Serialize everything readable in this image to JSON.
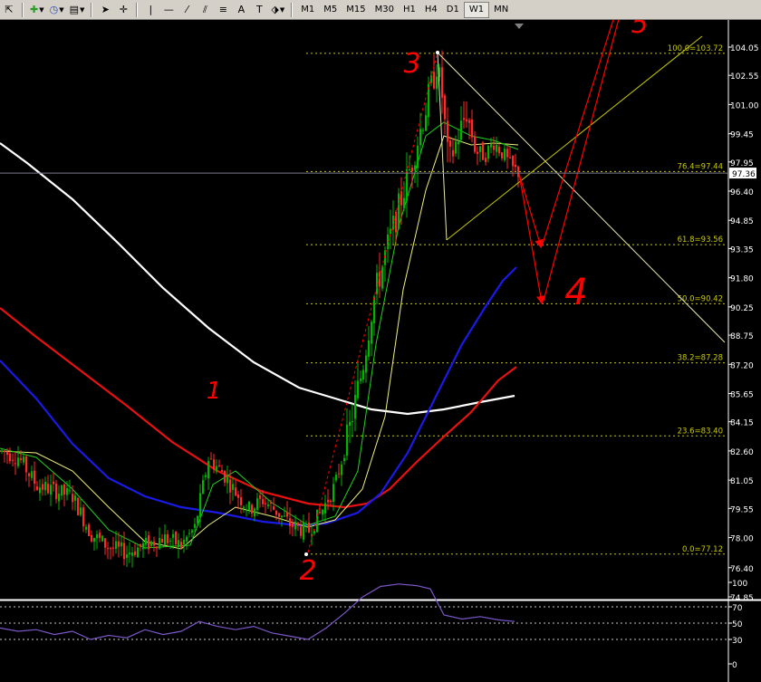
{
  "toolbar": {
    "timeframes": [
      "M1",
      "M5",
      "M15",
      "M30",
      "H1",
      "H4",
      "D1",
      "W1",
      "MN"
    ],
    "active_timeframe": "W1"
  },
  "chart_data": {
    "type": "candlestick",
    "price_axis": {
      "min": 74.85,
      "max": 104.05,
      "ticks": [
        "104.05",
        "102.55",
        "101.00",
        "99.45",
        "97.95",
        "96.40",
        "94.85",
        "93.35",
        "91.80",
        "90.25",
        "88.75",
        "87.20",
        "85.65",
        "84.15",
        "82.60",
        "81.05",
        "79.55",
        "78.00",
        "76.40",
        "74.85"
      ]
    },
    "current_price": "97.36",
    "fibonacci": [
      {
        "level": "100.0",
        "price": "103.72",
        "label": "100.0=103.72"
      },
      {
        "level": "76.4",
        "price": "97.44",
        "label": "76.4=97.44"
      },
      {
        "level": "61.8",
        "price": "93.56",
        "label": "61.8=93.56"
      },
      {
        "level": "50.0",
        "price": "90.42",
        "label": "50.0=90.42"
      },
      {
        "level": "38.2",
        "price": "87.28",
        "label": "38.2=87.28"
      },
      {
        "level": "23.6",
        "price": "83.40",
        "label": "23.6=83.40"
      },
      {
        "level": "0.0",
        "price": "77.12",
        "label": "0.0=77.12"
      }
    ],
    "annotations": [
      "1",
      "2",
      "3",
      "4",
      "5"
    ],
    "indicator_axis": {
      "ticks": [
        "100",
        "70",
        "50",
        "30",
        "0"
      ]
    },
    "colors": {
      "bull": "#00b400",
      "bear": "#ff2a2a",
      "ma_white": "#ffffff",
      "ma_red": "#e81010",
      "ma_blue": "#1a1ae6",
      "ma_yellow": "#f0f080",
      "ma_green": "#20d020",
      "fib": "#c8c800",
      "rsi": "#7b57c8",
      "annot": "#ff0000"
    }
  }
}
